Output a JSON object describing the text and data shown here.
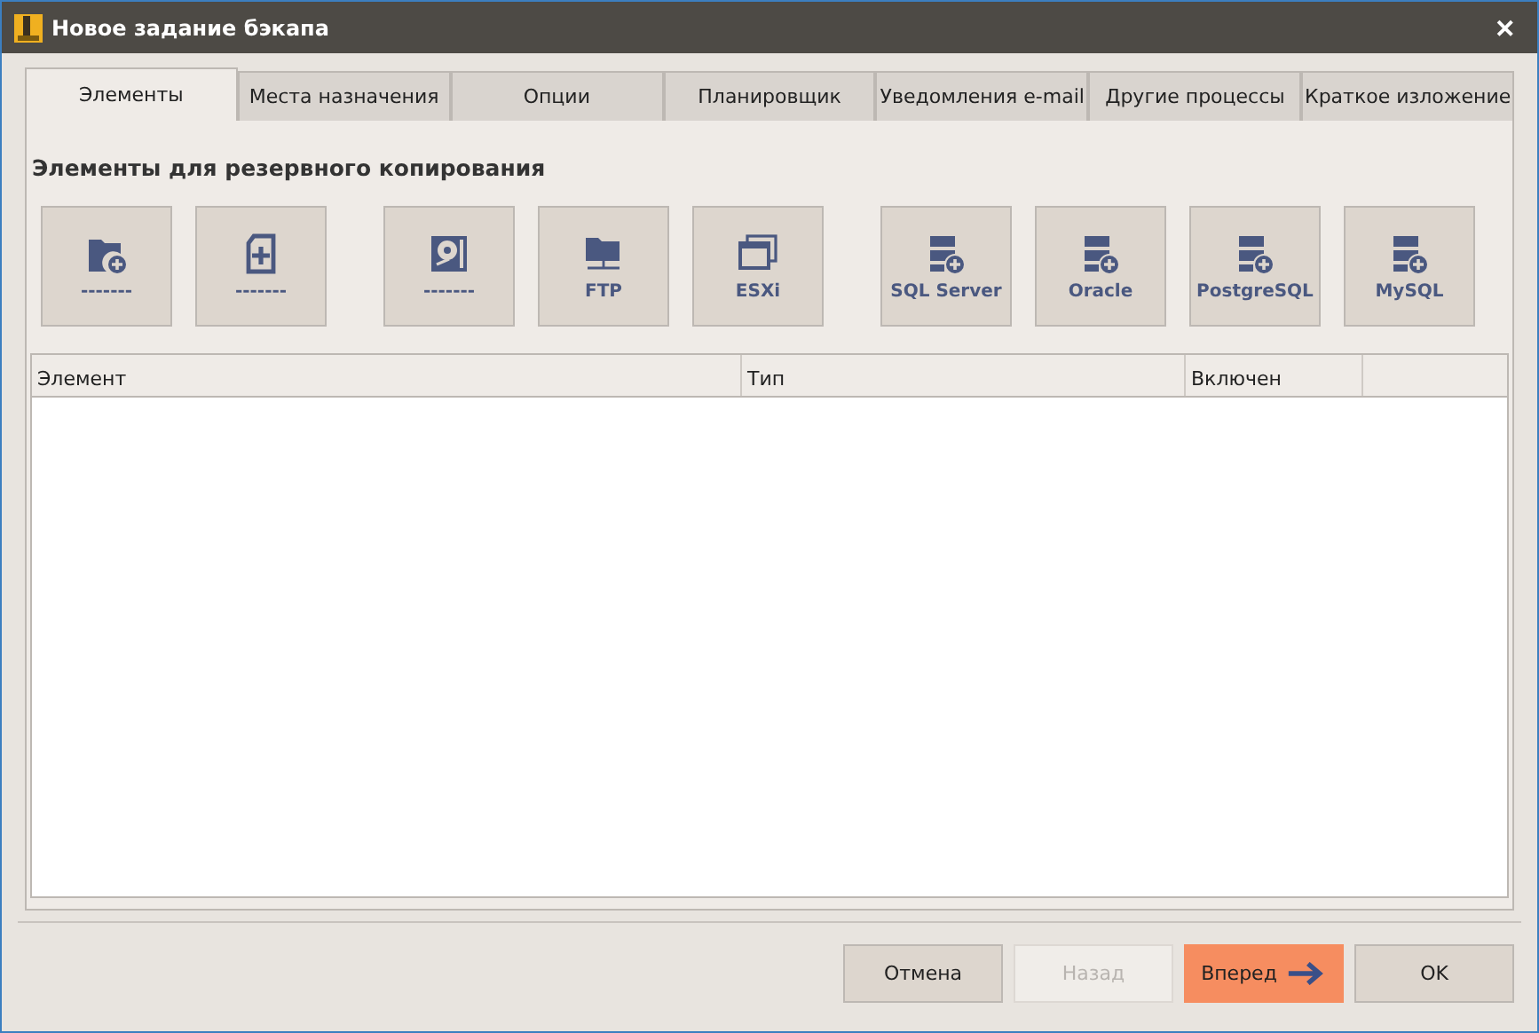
{
  "window": {
    "title": "Новое задание бэкапа",
    "close": "✕"
  },
  "tabs": [
    {
      "label": "Элементы",
      "selected": true
    },
    {
      "label": "Места назначения",
      "selected": false
    },
    {
      "label": "Опции",
      "selected": false
    },
    {
      "label": "Планировщик",
      "selected": false
    },
    {
      "label": "Уведомления e-mail",
      "selected": false
    },
    {
      "label": "Другие процессы",
      "selected": false
    },
    {
      "label": "Краткое изложение",
      "selected": false
    }
  ],
  "section_title": "Элементы для резервного копирования",
  "tile_groups": [
    [
      {
        "kind": "folder",
        "label": "-------"
      },
      {
        "kind": "file",
        "label": "-------"
      }
    ],
    [
      {
        "kind": "disk",
        "label": "-------"
      },
      {
        "kind": "ftp",
        "label": "FTP"
      },
      {
        "kind": "esxi",
        "label": "ESXi"
      }
    ],
    [
      {
        "kind": "db",
        "label": "SQL Server"
      },
      {
        "kind": "db",
        "label": "Oracle"
      },
      {
        "kind": "db",
        "label": "PostgreSQL"
      },
      {
        "kind": "db",
        "label": "MySQL"
      }
    ]
  ],
  "table": {
    "columns": [
      "Элемент",
      "Тип",
      "Включен"
    ]
  },
  "buttons": [
    {
      "label": "Отмена",
      "kind": "normal",
      "disabled": false
    },
    {
      "label": "Назад",
      "kind": "normal",
      "disabled": true
    },
    {
      "label": "Вперед",
      "kind": "primary",
      "disabled": false
    },
    {
      "label": "OK",
      "kind": "normal",
      "disabled": false
    }
  ]
}
